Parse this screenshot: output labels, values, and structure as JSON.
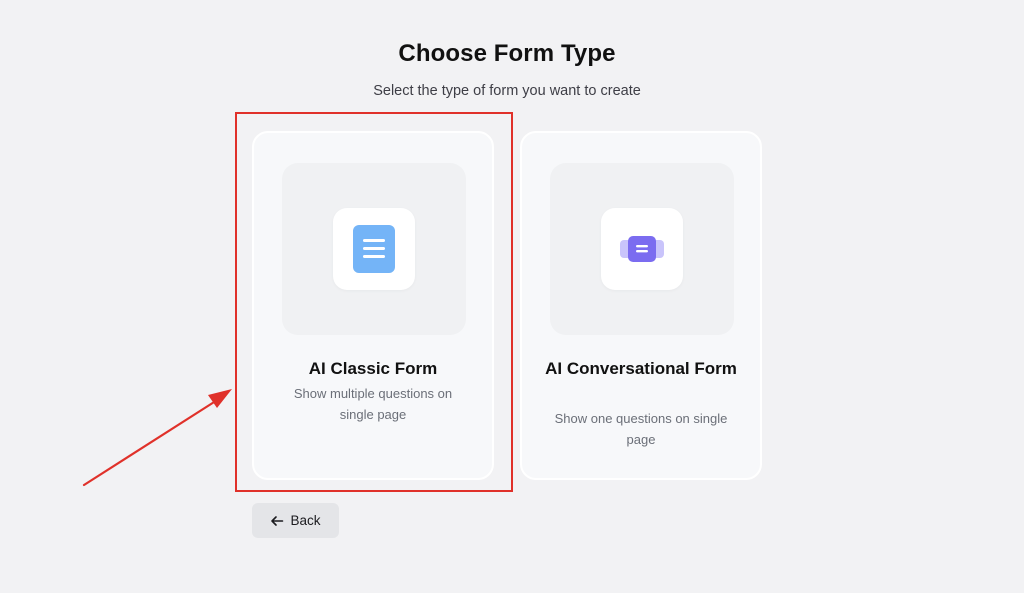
{
  "header": {
    "title": "Choose Form Type",
    "subtitle": "Select the type of form you want to create"
  },
  "options": [
    {
      "title": "AI Classic Form",
      "description": "Show multiple questions on single page",
      "icon": "document-lines-icon",
      "icon_color": "#74b4f7"
    },
    {
      "title": "AI Conversational Form",
      "description": "Show one questions on single page",
      "icon": "chat-card-icon",
      "icon_color": "#7b6cf0"
    }
  ],
  "footer": {
    "back_label": "Back",
    "back_icon": "arrow-left-icon"
  },
  "annotation": {
    "highlight_color": "#e0312a",
    "highlighted_option": "AI Classic Form"
  }
}
